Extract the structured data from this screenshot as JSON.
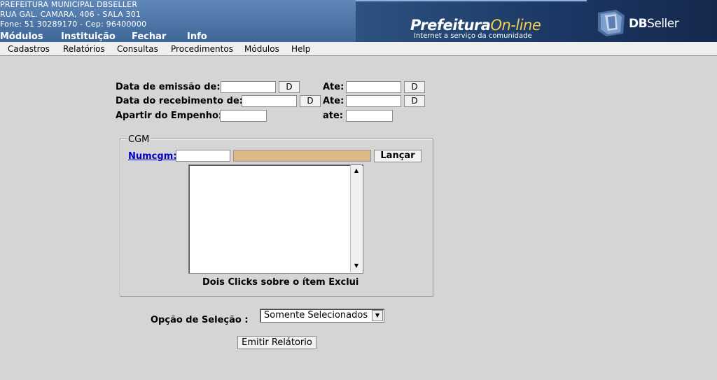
{
  "header": {
    "org_name": "PREFEITURA MUNICIPAL DBSELLER",
    "address": "RUA GAL. CAMARA, 406 - SALA 301",
    "contact": "Fone: 51 30289170  -  Cep: 96400000",
    "top_nav": [
      "Módulos",
      "Instituição",
      "Fechar",
      "Info"
    ],
    "banner": {
      "logo_prefix": "Prefeitura",
      "logo_suffix": "On-line",
      "logo_tagline": "Internet a serviço da comunidade",
      "brand_db": "DB",
      "brand_seller": "Seller",
      "accent_color": "#f2d24a"
    }
  },
  "menu": [
    "Cadastros",
    "Relatórios",
    "Consultas",
    "Procedimentos",
    "Módulos",
    "Help"
  ],
  "form": {
    "emissao_label": "Data de emissão de:",
    "recebimento_label": "Data do recebimento de:",
    "empenho_label": "Apartir do Empenho:",
    "ate_label_1": "Ate:",
    "ate_label_2": "Ate:",
    "ate_label_3": "ate:",
    "date_button": "D",
    "emissao_de": "",
    "emissao_ate": "",
    "recebimento_de": "",
    "recebimento_ate": "",
    "empenho_de": "",
    "empenho_ate": ""
  },
  "cgm": {
    "legend": "CGM",
    "numcgm_label": "Numcgm:",
    "numcgm_value": "",
    "nome_value": "",
    "lancar_label": "Lançar",
    "hint": "Dois Clicks sobre o ítem Exclui",
    "field_color": "#deb887"
  },
  "opcao": {
    "label": "Opção de Seleção :",
    "selected": "Somente Selecionados"
  },
  "emitir_label": "Emitir Relátorio"
}
